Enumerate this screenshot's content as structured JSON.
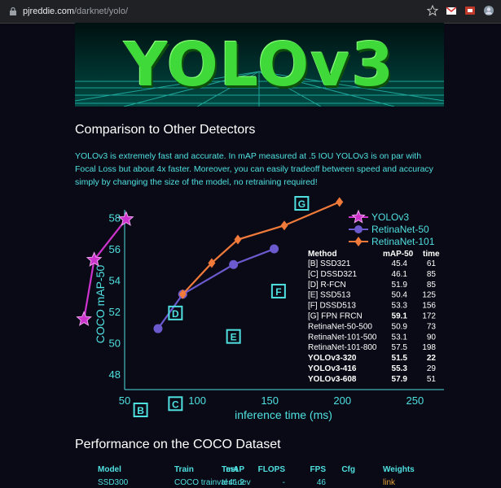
{
  "browser": {
    "url_domain": "pjreddie.com",
    "url_path": "/darknet/yolo/"
  },
  "banner": {
    "title": "YOLOv3"
  },
  "section1": {
    "heading": "Comparison to Other Detectors",
    "paragraph": "YOLOv3 is extremely fast and accurate. In mAP measured at .5 IOU YOLOv3 is on par with Focal Loss but about 4x faster. Moreover, you can easily tradeoff between speed and accuracy simply by changing the size of the model, no retraining required!"
  },
  "chart_data": {
    "type": "scatter",
    "xlabel": "inference time (ms)",
    "ylabel": "COCO mAP-50",
    "xlim": [
      50,
      270
    ],
    "ylim": [
      47,
      58.5
    ],
    "x_ticks": [
      "50",
      "100",
      "150",
      "200",
      "250"
    ],
    "y_ticks": [
      "48",
      "50",
      "52",
      "54",
      "56",
      "58"
    ],
    "legend": [
      "YOLOv3",
      "RetinaNet-50",
      "RetinaNet-101"
    ],
    "series": [
      {
        "name": "YOLOv3",
        "color": "#cc33cc",
        "marker": "star",
        "x": [
          22,
          29,
          51
        ],
        "y": [
          51.5,
          55.3,
          57.9
        ]
      },
      {
        "name": "RetinaNet-50",
        "color": "#6a5acd",
        "marker": "circle",
        "x": [
          73,
          90,
          125,
          153
        ],
        "y": [
          50.9,
          53.1,
          55.0,
          56.0
        ]
      },
      {
        "name": "RetinaNet-101",
        "color": "#f07a3a",
        "marker": "diamond",
        "x": [
          90,
          110,
          128,
          160,
          198
        ],
        "y": [
          53.1,
          55.1,
          56.6,
          57.5,
          59.0
        ]
      }
    ],
    "labeled_points": [
      {
        "label": "B",
        "x": 61,
        "y": 45.4
      },
      {
        "label": "C",
        "x": 85,
        "y": 46.1
      },
      {
        "label": "D",
        "x": 85,
        "y": 51.9
      },
      {
        "label": "E",
        "x": 125,
        "y": 50.4
      },
      {
        "label": "F",
        "x": 156,
        "y": 53.3
      },
      {
        "label": "G",
        "x": 172,
        "y": 59.1
      }
    ],
    "table": {
      "headers": [
        "Method",
        "mAP-50",
        "time"
      ],
      "rows": [
        {
          "method": "[B] SSD321",
          "map": "45.4",
          "time": "61",
          "bold": false
        },
        {
          "method": "[C] DSSD321",
          "map": "46.1",
          "time": "85",
          "bold": false
        },
        {
          "method": "[D] R-FCN",
          "map": "51.9",
          "time": "85",
          "bold": false
        },
        {
          "method": "[E] SSD513",
          "map": "50.4",
          "time": "125",
          "bold": false
        },
        {
          "method": "[F] DSSD513",
          "map": "53.3",
          "time": "156",
          "bold": false
        },
        {
          "method": "[G] FPN FRCN",
          "map": "59.1",
          "time": "172",
          "bold": false,
          "bold_map": true
        },
        {
          "method": "RetinaNet-50-500",
          "map": "50.9",
          "time": "73",
          "bold": false
        },
        {
          "method": "RetinaNet-101-500",
          "map": "53.1",
          "time": "90",
          "bold": false
        },
        {
          "method": "RetinaNet-101-800",
          "map": "57.5",
          "time": "198",
          "bold": false
        },
        {
          "method": "YOLOv3-320",
          "map": "51.5",
          "time": "22",
          "bold": true,
          "bold_time": true
        },
        {
          "method": "YOLOv3-416",
          "map": "55.3",
          "time": "29",
          "bold": true
        },
        {
          "method": "YOLOv3-608",
          "map": "57.9",
          "time": "51",
          "bold": true
        }
      ]
    }
  },
  "section2": {
    "heading": "Performance on the COCO Dataset",
    "table_headers": [
      "Model",
      "Train",
      "Test",
      "mAP",
      "FLOPS",
      "FPS",
      "Cfg",
      "Weights"
    ],
    "rows": [
      [
        "SSD300",
        "COCO trainval",
        "test-dev",
        "41.2",
        "-",
        "46",
        "",
        "link"
      ]
    ]
  }
}
